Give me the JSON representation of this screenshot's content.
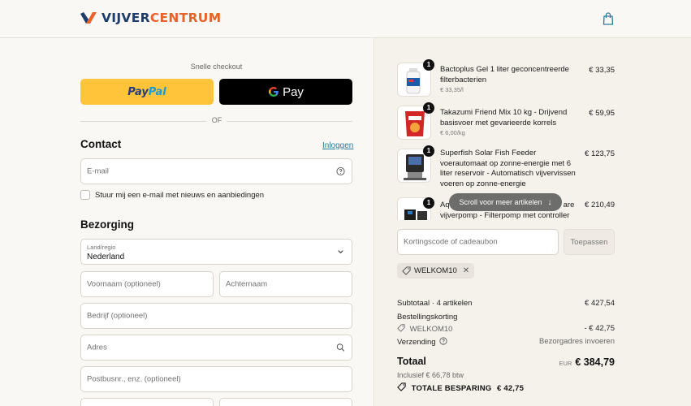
{
  "brand": {
    "name_part1": "VIJVER",
    "name_part2": "CENTRUM",
    "accent": "#e8622a",
    "navy": "#1d3d6b"
  },
  "header": {
    "cart_icon": "shopping-bag-icon"
  },
  "express": {
    "label": "Snelle checkout",
    "paypal": {
      "part1": "Pay",
      "part2": "Pal"
    },
    "gpay": {
      "label": "Pay"
    },
    "or": "OF"
  },
  "contact": {
    "title": "Contact",
    "login_link": "Inloggen",
    "email_placeholder": "E-mail",
    "newsletter_label": "Stuur mij een e-mail met nieuws en aanbiedingen"
  },
  "delivery": {
    "title": "Bezorging",
    "country_label": "Land/regio",
    "country_value": "Nederland",
    "first_name_placeholder": "Voornaam (optioneel)",
    "last_name_placeholder": "Achternaam",
    "company_placeholder": "Bedrijf (optioneel)",
    "address_placeholder": "Adres",
    "address2_placeholder": "Postbusnr., enz. (optioneel)"
  },
  "cart": {
    "items": [
      {
        "qty": "1",
        "name": "Bactoplus Gel 1 liter geconcentreerde filterbacterien",
        "sub": "€ 33,35/l",
        "price": "€ 33,35"
      },
      {
        "qty": "1",
        "name": "Takazumi Friend Mix 10 kg - Drijvend basisvoer met gevarieerde korrels",
        "sub": "€ 6,00/kg",
        "price": "€ 59,95"
      },
      {
        "qty": "1",
        "name": "Superfish Solar Fish Feeder voerautomaat op zonne-energie met 6 liter reservoir - Automatisch vijvervissen voeren op zonne-energie",
        "sub": "",
        "price": "€ 123,75"
      },
      {
        "qty": "1",
        "name_part1": "Aq",
        "name_part2": "are",
        "name_line2": "vijverpomp - Filterpomp met controller",
        "price": "€ 210,49"
      }
    ],
    "scroll_hint": "Scroll voor meer artikelen",
    "discount_placeholder": "Kortingscode of cadeaubon",
    "apply_label": "Toepassen",
    "applied_code": "WELKOM10"
  },
  "summary": {
    "subtotal_label": "Subtotaal · 4 artikelen",
    "subtotal_value": "€ 427,54",
    "order_discount_label": "Bestellingskorting",
    "discount_code": "WELKOM10",
    "discount_value": "- € 42,75",
    "shipping_label": "Verzending",
    "shipping_value": "Bezorgadres invoeren",
    "total_label": "Totaal",
    "currency": "EUR",
    "total_value": "€ 384,79",
    "tax_note": "Inclusief € 66,78 btw",
    "savings_label": "TOTALE BESPARING",
    "savings_value": "€ 42,75"
  }
}
